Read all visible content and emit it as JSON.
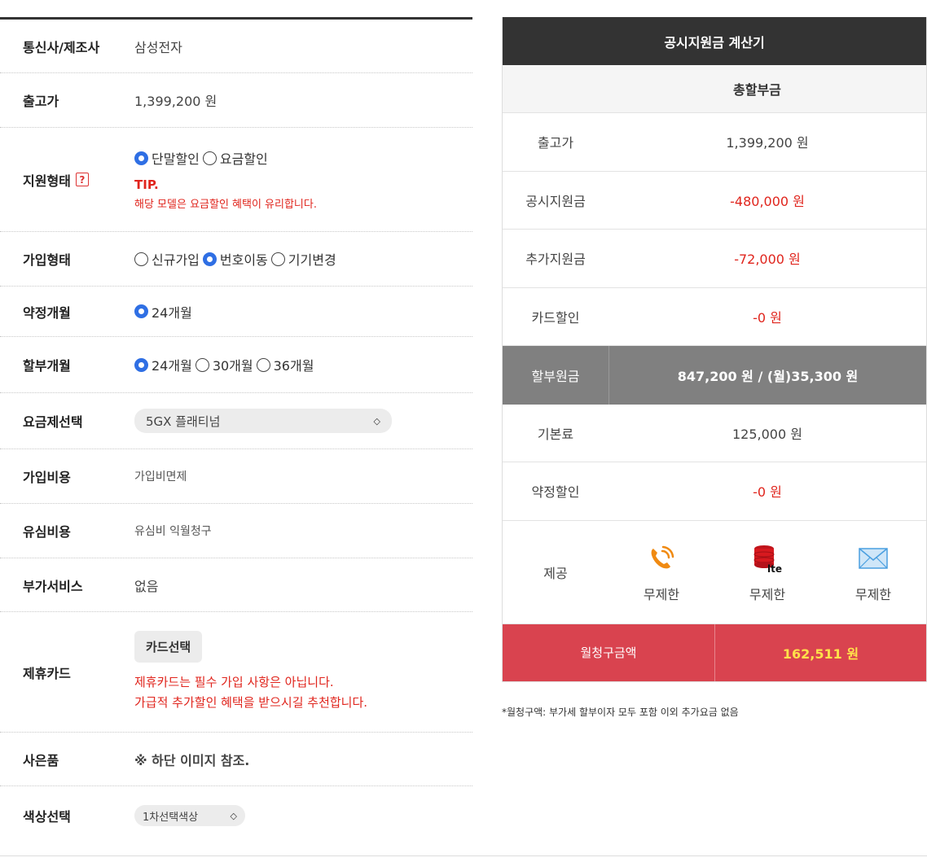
{
  "form": {
    "carrier": {
      "label": "통신사/제조사",
      "value": "삼성전자"
    },
    "price": {
      "label": "출고가",
      "value": "1,399,200 원"
    },
    "support_type": {
      "label": "지원형태",
      "help": "?",
      "options": [
        "단말할인",
        "요금할인"
      ],
      "selected": "단말할인",
      "tip_title": "TIP.",
      "tip_text": "해당 모델은 요금할인 혜택이 유리합니다."
    },
    "join_type": {
      "label": "가입형태",
      "options": [
        "신규가입",
        "번호이동",
        "기기변경"
      ],
      "selected": "번호이동"
    },
    "contract": {
      "label": "약정개월",
      "options": [
        "24개월"
      ],
      "selected": "24개월"
    },
    "installment": {
      "label": "할부개월",
      "options": [
        "24개월",
        "30개월",
        "36개월"
      ],
      "selected": "24개월"
    },
    "plan": {
      "label": "요금제선택",
      "value": "5GX 플래티넘"
    },
    "join_fee": {
      "label": "가입비용",
      "value": "가입비면제"
    },
    "usim_fee": {
      "label": "유심비용",
      "value": "유심비 익월청구"
    },
    "addon": {
      "label": "부가서비스",
      "value": "없음"
    },
    "card": {
      "label": "제휴카드",
      "button": "카드선택",
      "warn1": "제휴카드는 필수 가입 사항은 아닙니다.",
      "warn2": "가급적 추가할인 혜택을 받으시길 추천합니다."
    },
    "gift": {
      "label": "사은품",
      "value": "※ 하단 이미지 참조."
    },
    "color": {
      "label": "색상선택",
      "value": "1차선택색상"
    }
  },
  "calc": {
    "title": "공시지원금 계산기",
    "subtitle": "총할부금",
    "rows": [
      {
        "label": "출고가",
        "value": "1,399,200 원",
        "red": false
      },
      {
        "label": "공시지원금",
        "value": "-480,000 원",
        "red": true
      },
      {
        "label": "추가지원금",
        "value": "-72,000 원",
        "red": true
      },
      {
        "label": "카드할인",
        "value": "-0 원",
        "red": true
      }
    ],
    "principal": {
      "label": "할부원금",
      "value": "847,200 원 / (월)35,300 원"
    },
    "rows2": [
      {
        "label": "기본료",
        "value": "125,000 원",
        "red": false
      },
      {
        "label": "약정할인",
        "value": "-0 원",
        "red": true
      }
    ],
    "provide": {
      "label": "제공",
      "items": [
        {
          "icon": "phone-call-icon",
          "text": "무제한"
        },
        {
          "icon": "lte-data-icon",
          "text": "무제한"
        },
        {
          "icon": "mail-icon",
          "text": "무제한"
        }
      ]
    },
    "total": {
      "label": "월청구금액",
      "value": "162,511 원"
    }
  },
  "note": "*월청구액: 부가세 할부이자 모두 포함 이외 추가요금 없음",
  "colors": {
    "accent": "#2f6fe4",
    "warn": "#e0251d",
    "total_bg": "#d9434f",
    "total_text": "#ffe14a"
  }
}
